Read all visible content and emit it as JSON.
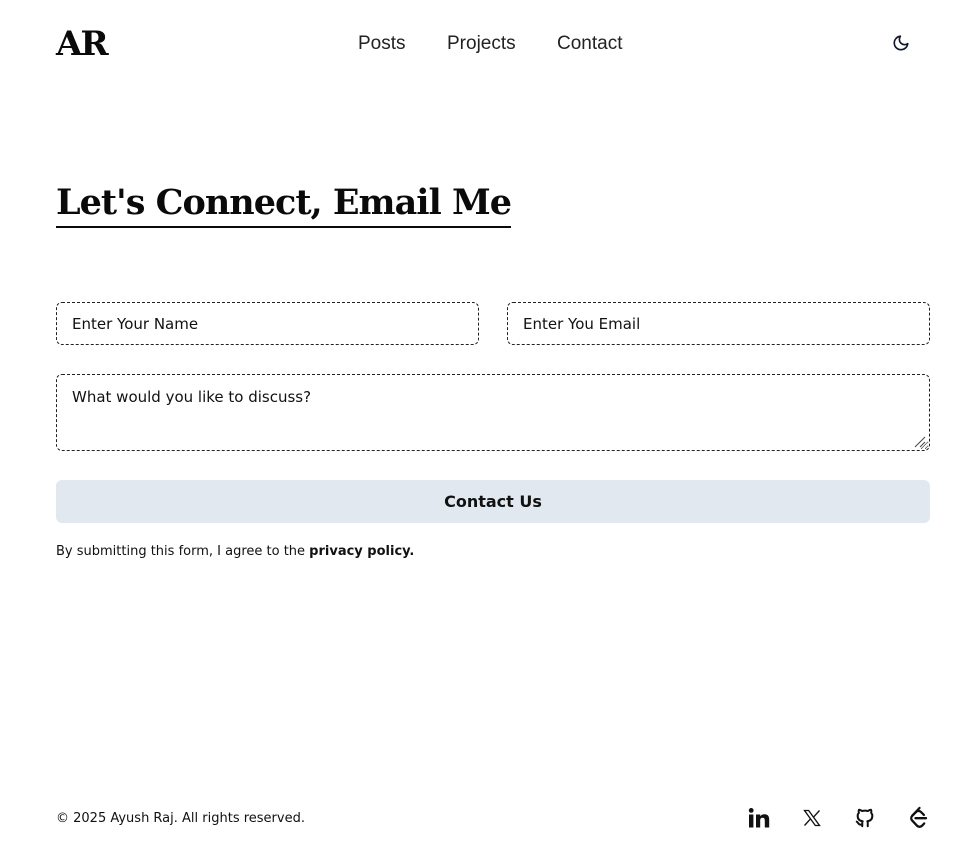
{
  "header": {
    "logo": "AR",
    "nav": [
      "Posts",
      "Projects",
      "Contact"
    ],
    "theme_icon": "moon-icon"
  },
  "main": {
    "heading": "Let's Connect, Email Me",
    "form": {
      "name_placeholder": "Enter Your Name",
      "email_placeholder": "Enter You Email",
      "message_placeholder": "What would you like to discuss?",
      "submit_label": "Contact Us",
      "consent_text": "By submitting this form, I agree to the ",
      "consent_link": "privacy policy.",
      "submit_bg": "#e2e8f0"
    }
  },
  "footer": {
    "copyright": "© 2025 Ayush Raj. All rights reserved.",
    "social": [
      "linkedin-icon",
      "x-icon",
      "github-icon",
      "leetcode-icon"
    ]
  }
}
